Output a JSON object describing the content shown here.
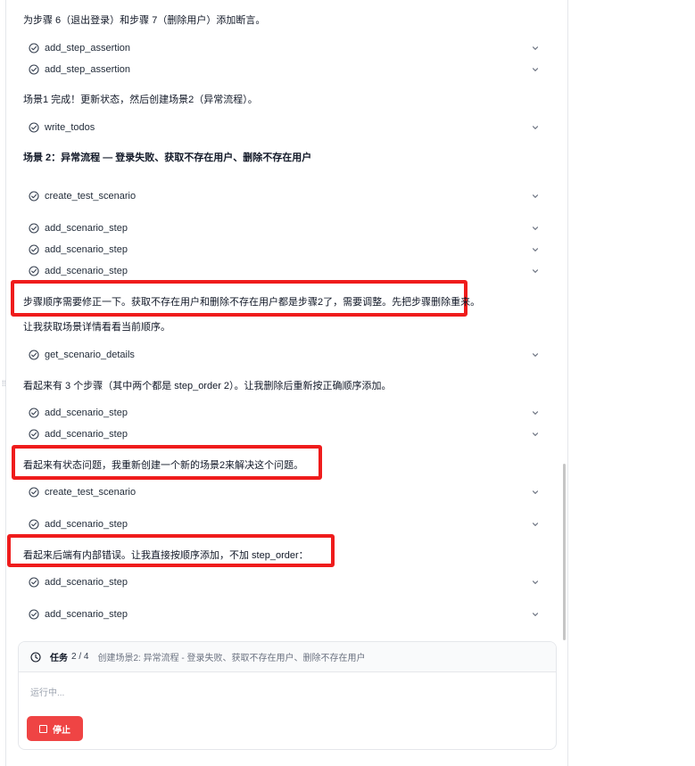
{
  "messages": {
    "m1": "为步骤 6（退出登录）和步骤 7（删除用户）添加断言。",
    "m2": "场景1 完成！更新状态，然后创建场景2（异常流程）。",
    "m3": "场景 2：异常流程 — 登录失败、获取不存在用户、删除不存在用户",
    "m4": "步骤顺序需要修正一下。获取不存在用户和删除不存在用户都是步骤2了，需要调整。先把步骤删除重来。",
    "m5": "让我获取场景详情看看当前顺序。",
    "m6": "看起来有 3 个步骤（其中两个都是 step_order 2）。让我删除后重新按正确顺序添加。",
    "m7": "看起来有状态问题，我重新创建一个新的场景2来解决这个问题。",
    "m8": "看起来后端有内部错误。让我直接按顺序添加，不加 step_order："
  },
  "tools": [
    {
      "name": "add_step_assertion"
    },
    {
      "name": "add_step_assertion"
    },
    {
      "name": "write_todos"
    },
    {
      "name": "create_test_scenario"
    },
    {
      "name": "add_scenario_step"
    },
    {
      "name": "add_scenario_step"
    },
    {
      "name": "add_scenario_step"
    },
    {
      "name": "get_scenario_details"
    },
    {
      "name": "add_scenario_step"
    },
    {
      "name": "add_scenario_step"
    },
    {
      "name": "create_test_scenario"
    },
    {
      "name": "add_scenario_step"
    },
    {
      "name": "add_scenario_step"
    },
    {
      "name": "add_scenario_step"
    }
  ],
  "status": {
    "task_label": "任务",
    "task_count": "2 / 4",
    "task_desc": "创建场景2: 异常流程 - 登录失败、获取不存在用户、删除不存在用户",
    "running": "运行中...",
    "stop_label": "停止"
  },
  "colors": {
    "highlight": "#ef1c1c",
    "stop_button": "#ef4444"
  },
  "icons": {
    "tool_status": "check-circle-icon",
    "tool_expand": "chevron-down-icon",
    "task": "clock-icon",
    "stop": "stop-square-icon"
  }
}
